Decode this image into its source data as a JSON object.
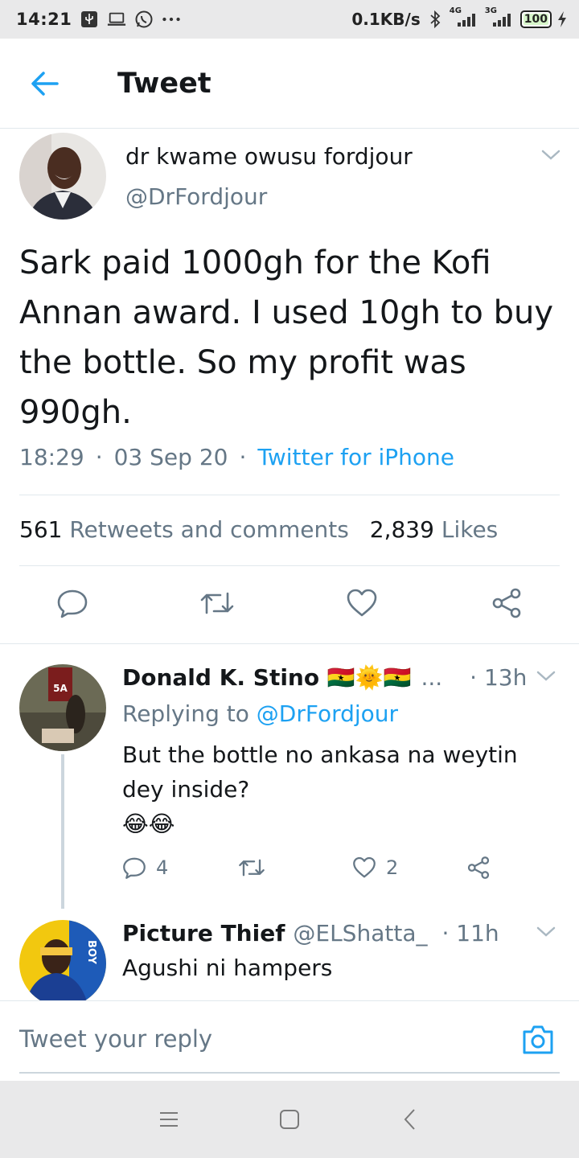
{
  "status_bar": {
    "time": "14:21",
    "network_speed": "0.1KB/s",
    "signal_1_label": "4G",
    "signal_2_label": "3G",
    "battery": "100",
    "icons": [
      "usb-icon",
      "laptop-icon",
      "whatsapp-icon",
      "more-icon",
      "bluetooth-icon",
      "signal-icon",
      "battery-icon",
      "charging-icon"
    ]
  },
  "header": {
    "title": "Tweet",
    "back_icon": "arrow-left-icon"
  },
  "main_tweet": {
    "author_name": "dr kwame owusu fordjour",
    "author_handle": "@DrFordjour",
    "text": "Sark paid 1000gh for the Kofi Annan award. I used 10gh to buy the bottle. So my profit was 990gh.",
    "time": "18:29",
    "date": "03 Sep 20",
    "source": "Twitter for iPhone",
    "retweets_count": "561",
    "retweets_label": "Retweets and comments",
    "likes_count": "2,839",
    "likes_label": "Likes"
  },
  "replies": [
    {
      "name": "Donald K. Stino 🇬🇭🌞🇬🇭",
      "ellipsis": "...",
      "time": "· 13h",
      "replying_prefix": "Replying to",
      "replying_handle": "@DrFordjour",
      "text": "But the bottle no ankasa na weytin dey inside?",
      "emoji": "😂😂",
      "reply_count": "4",
      "like_count": "2"
    },
    {
      "name": "Picture Thief",
      "handle": "@ELShatta_",
      "time": "· 11h",
      "text": "Agushi ni hampers"
    }
  ],
  "composer": {
    "placeholder": "Tweet your reply",
    "camera_icon": "camera-icon"
  },
  "colors": {
    "accent": "#1da1f2",
    "secondary_text": "#657786",
    "primary_text": "#14171a",
    "divider": "#e1e8ed"
  }
}
